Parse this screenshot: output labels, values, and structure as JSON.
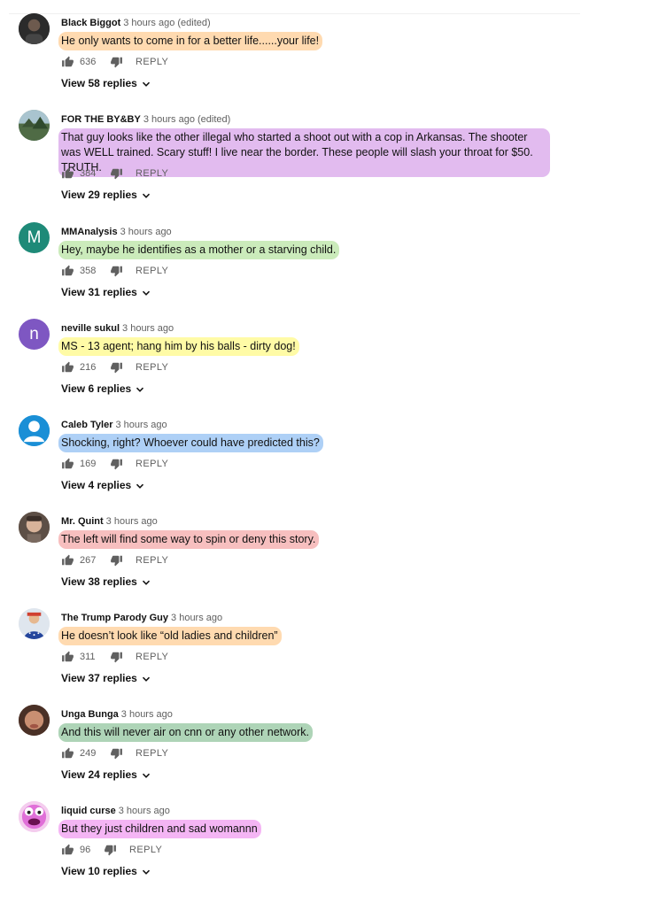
{
  "actions": {
    "reply_label": "REPLY"
  },
  "icons": {
    "like": "thumbs-up-icon",
    "dislike": "thumbs-down-icon",
    "expand": "chevron-down-icon"
  },
  "comments": [
    {
      "author": "Black Biggot",
      "meta": "3 hours ago (edited)",
      "text": "He only wants to come in for a better life......your life!",
      "likes": "636",
      "replies": "View 58 replies",
      "highlight": "#ffcd96",
      "avatar": "photo"
    },
    {
      "author": "FOR THE BY&BY",
      "meta": "3 hours ago (edited)",
      "text": "That guy looks like the other illegal who started a shoot out with a cop in Arkansas. The shooter was WELL trained.  Scary stuff!  I live near the border.  These people will slash your throat for $50. TRUTH.",
      "likes": "384",
      "replies": "View 29 replies",
      "highlight": "#d296e6",
      "avatar": "photo"
    },
    {
      "author": "MMAnalysis",
      "meta": "3 hours ago",
      "text": "Hey, maybe he identifies as a mother or a starving child.",
      "likes": "358",
      "replies": "View 31 replies",
      "highlight": "#bee6aa",
      "avatar": "M",
      "avatar_color": "#1e8a78"
    },
    {
      "author": "neville sukul",
      "meta": "3 hours ago",
      "text": "MS - 13 agent; hang him by his balls - dirty dog!",
      "likes": "216",
      "replies": "View 6 replies",
      "highlight": "#fffa96",
      "avatar": "n",
      "avatar_color": "#7e57c2"
    },
    {
      "author": "Caleb Tyler",
      "meta": "3 hours ago",
      "text": "Shocking, right? Whoever could have predicted this?",
      "likes": "169",
      "replies": "View 4 replies",
      "highlight": "#a0c8f5",
      "avatar": "default",
      "avatar_color": "#1a8fd6"
    },
    {
      "author": "Mr. Quint",
      "meta": "3 hours ago",
      "text": "The left will find some way to spin or deny this story.",
      "likes": "267",
      "replies": "View 38 replies",
      "highlight": "#f5afaf",
      "avatar": "photo"
    },
    {
      "author": "The Trump Parody Guy",
      "meta": "3 hours ago",
      "text": "He doesn’t look like “old ladies and children”",
      "likes": "311",
      "replies": "View 37 replies",
      "highlight": "#ffcd96",
      "avatar": "photo"
    },
    {
      "author": "Unga Bunga",
      "meta": "3 hours ago",
      "text": "And this will never air on cnn or any other network.",
      "likes": "249",
      "replies": "View 24 replies",
      "highlight": "#a0cdaa",
      "avatar": "photo"
    },
    {
      "author": "liquid curse",
      "meta": "3 hours ago",
      "text": "But they just children and sad womannn",
      "likes": "96",
      "replies": "View 10 replies",
      "highlight": "#f096f0",
      "avatar": "cartoon"
    }
  ]
}
